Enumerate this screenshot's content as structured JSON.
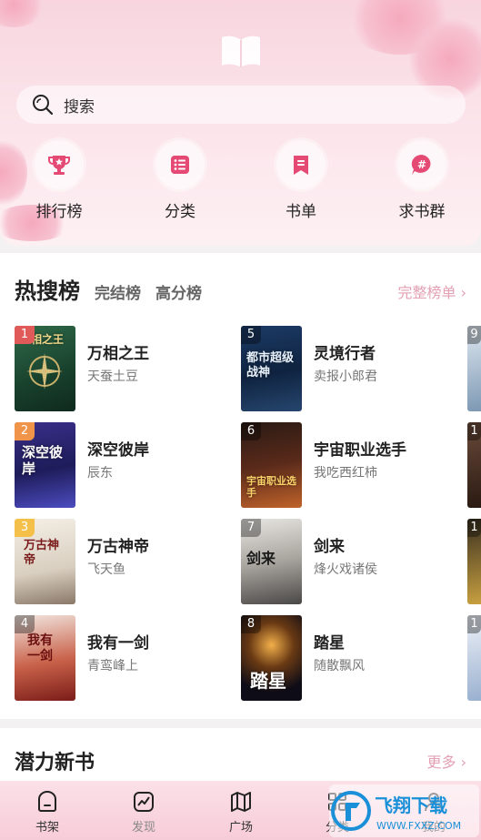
{
  "search": {
    "placeholder": "搜索"
  },
  "quick_links": [
    {
      "label": "排行榜",
      "icon": "trophy-icon"
    },
    {
      "label": "分类",
      "icon": "list-icon"
    },
    {
      "label": "书单",
      "icon": "bookmark-icon"
    },
    {
      "label": "求书群",
      "icon": "hashtag-icon"
    }
  ],
  "hot": {
    "title": "热搜榜",
    "tabs": [
      "完结榜",
      "高分榜"
    ],
    "more": "完整榜单 ›",
    "books": [
      {
        "rank": "1",
        "title": "万相之王",
        "author": "天蚕土豆",
        "cover_text": "相之王"
      },
      {
        "rank": "2",
        "title": "深空彼岸",
        "author": "辰东",
        "cover_text": "深空彼岸"
      },
      {
        "rank": "3",
        "title": "万古神帝",
        "author": "飞天鱼",
        "cover_text": "万古神帝"
      },
      {
        "rank": "4",
        "title": "我有一剑",
        "author": "青鸾峰上",
        "cover_text": "我有一剑"
      },
      {
        "rank": "5",
        "title": "灵境行者",
        "author": "卖报小郎君",
        "cover_text": "都市超级战神"
      },
      {
        "rank": "6",
        "title": "宇宙职业选手",
        "author": "我吃西红柿",
        "cover_text": "宇宙职业选手"
      },
      {
        "rank": "7",
        "title": "剑来",
        "author": "烽火戏诸侯",
        "cover_text": "剑来"
      },
      {
        "rank": "8",
        "title": "踏星",
        "author": "随散飘风",
        "cover_text": "踏星"
      }
    ],
    "partial_ranks": [
      "9",
      "1",
      "1",
      "1"
    ]
  },
  "new_books": {
    "title": "潜力新书",
    "more": "更多 ›"
  },
  "nav": [
    {
      "label": "书架",
      "icon": "shelf-icon"
    },
    {
      "label": "发现",
      "icon": "discover-icon"
    },
    {
      "label": "广场",
      "icon": "map-icon"
    },
    {
      "label": "分类",
      "icon": "category-icon"
    },
    {
      "label": "我的",
      "icon": "profile-icon"
    }
  ],
  "watermark": {
    "text": "飞翔下载",
    "url": "WWW.FXXZ.COM"
  },
  "colors": {
    "accent": "#e3a0b4",
    "quick_icon": "#e44a74",
    "header_bg": "#f8d5df"
  }
}
